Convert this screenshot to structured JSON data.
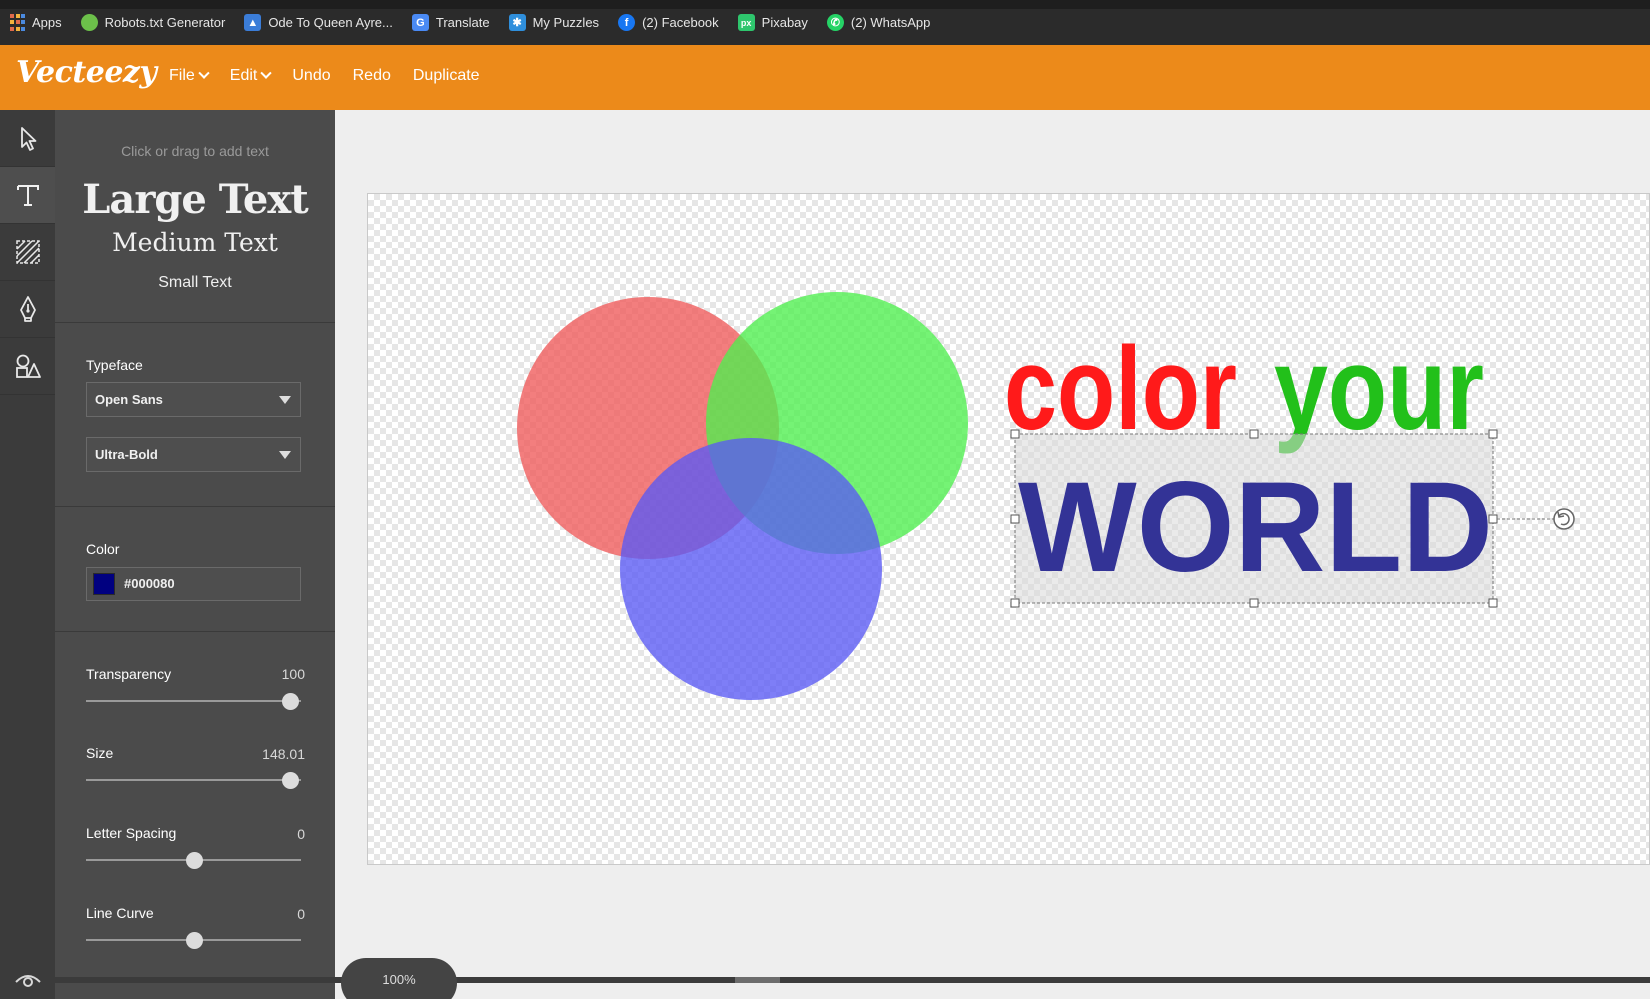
{
  "bookmarks": [
    {
      "label": "Apps",
      "icon": "apps-grid-icon"
    },
    {
      "label": "Robots.txt Generator",
      "icon": "robots-icon",
      "color": "#6cc04a"
    },
    {
      "label": "Ode To Queen Ayre...",
      "icon": "photo-icon",
      "color": "#3b7dd8"
    },
    {
      "label": "Translate",
      "icon": "translate-icon",
      "color": "#4a8af4"
    },
    {
      "label": "My Puzzles",
      "icon": "puzzle-icon",
      "color": "#2f8fdc"
    },
    {
      "label": "(2) Facebook",
      "icon": "facebook-icon",
      "color": "#1877f2"
    },
    {
      "label": "Pixabay",
      "icon": "pixabay-icon",
      "color": "#2ec66d"
    },
    {
      "label": "(2) WhatsApp",
      "icon": "whatsapp-icon",
      "color": "#25d366"
    }
  ],
  "app": {
    "logo": "Vecteezy",
    "brand_color": "#ec8a1a",
    "menu": [
      {
        "label": "File",
        "dropdown": true
      },
      {
        "label": "Edit",
        "dropdown": true
      },
      {
        "label": "Undo",
        "dropdown": false
      },
      {
        "label": "Redo",
        "dropdown": false
      },
      {
        "label": "Duplicate",
        "dropdown": false
      }
    ]
  },
  "tools": [
    {
      "name": "select-tool",
      "icon": "cursor-arrow-icon",
      "active": false
    },
    {
      "name": "text-tool",
      "icon": "text-t-icon",
      "active": true
    },
    {
      "name": "pattern-tool",
      "icon": "hatch-pattern-icon",
      "active": false
    },
    {
      "name": "pen-tool",
      "icon": "pen-nib-icon",
      "active": false
    },
    {
      "name": "shapes-tool",
      "icon": "shapes-icon",
      "active": false
    }
  ],
  "text_panel": {
    "hint": "Click or drag to add text",
    "large": "Large Text",
    "medium": "Medium Text",
    "small": "Small Text"
  },
  "properties": {
    "typeface_label": "Typeface",
    "typeface": "Open Sans",
    "weight": "Ultra-Bold",
    "color_label": "Color",
    "color_hex": "#000080",
    "transparency_label": "Transparency",
    "transparency": 100,
    "transparency_slider": 0.95,
    "size_label": "Size",
    "size": "148.01",
    "size_slider": 0.95,
    "letter_spacing_label": "Letter Spacing",
    "letter_spacing": 0,
    "letter_spacing_slider": 0.5,
    "line_curve_label": "Line Curve",
    "line_curve": 0,
    "line_curve_slider": 0.5
  },
  "canvas": {
    "word1": "color",
    "word1_color": "#ff1a1a",
    "word2": "your",
    "word2_color": "#22c01a",
    "word3": "WORLD",
    "word3_color": "#333396",
    "circle_colors": [
      "#f05a5a",
      "#4ef04e",
      "#5a5af5"
    ]
  },
  "zoom": "100%"
}
